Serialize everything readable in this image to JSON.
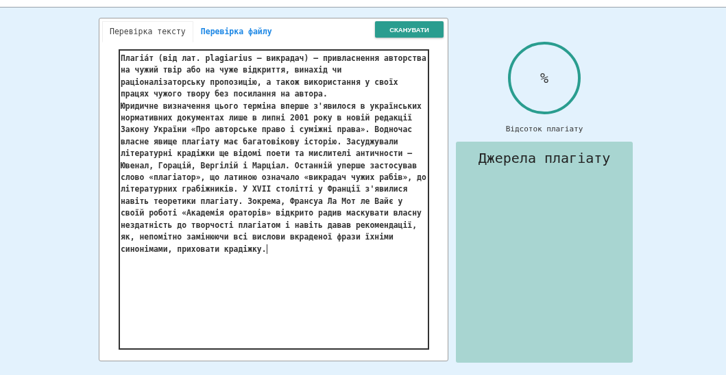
{
  "tabs": [
    {
      "label": "Перевірка тексту",
      "selected": true
    },
    {
      "label": "Перевірка файлу",
      "selected": false
    }
  ],
  "scan_button": "СКАНУВАТИ",
  "text_field": {
    "value": "Плагіáт (від лат. plagiarius — викрадач) — привласнення авторства\nна чужий твір або на чуже відкриття, винахід чи\nраціоналізаторську пропозицію, а також використання у своїх\nпрацях чужого твору без посилання на автора.\nЮридичне визначення цього терміна вперше з'явилося в українських\nнормативних документах лише в липні 2001 року в новій редакції\nЗакону України «Про авторське право і суміжні права». Водночас\nвласне явище плагіату має багатовікову історію. Засуджували\nлітературні крадіжки ще відомі поети та мислителі античности —\nЮвенал, Горацій, Вергілій і Марціал. Останній уперше застосував\nслово «плагіатор», що латиною означало «викрадач чужих рабів», до\nлітературних грабіжників. У XVII столітті у Франції з'явилися\nнавіть теоретики плагіату. Зокрема, Франсуа Ла Мот ле Вайє у\nсвоїй роботі «Академія ораторів» відкрито радив маскувати власну\nнездатність до творчості плагіатом і навіть давав рекомендації,\nяк, непомітно замінюючи всі вислови вкраденої фрази їхніми\nсинонімами, приховати крадіжку."
  },
  "gauge": {
    "value": "%",
    "caption": "Відсоток плагіату"
  },
  "sources": {
    "title": "Джерела плагіату"
  }
}
